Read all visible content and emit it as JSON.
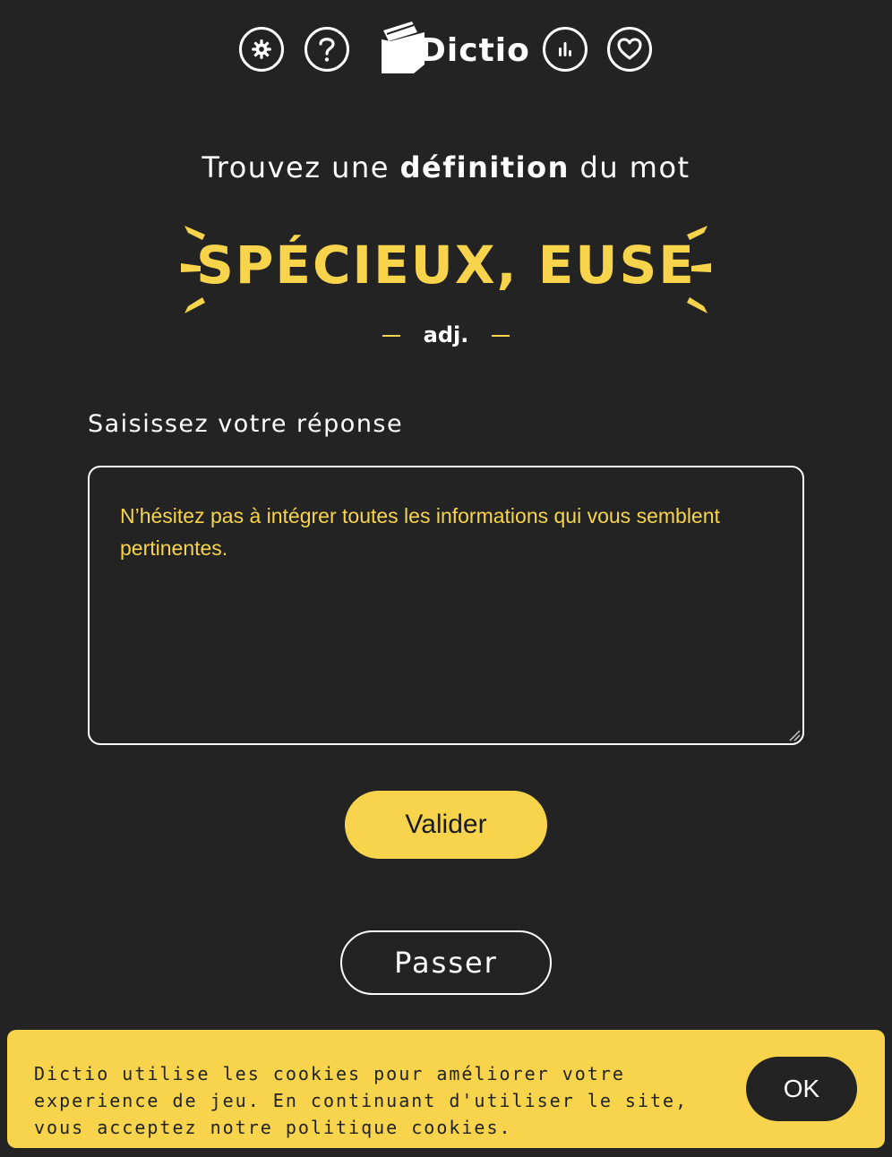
{
  "header": {
    "logo_text": "Dictio",
    "icons": [
      "settings-icon",
      "help-icon",
      "stats-icon",
      "heart-icon"
    ]
  },
  "intro": {
    "prefix": "Trouvez une ",
    "emphasis": "définition",
    "suffix": " du mot"
  },
  "word": {
    "text": "SPÉCIEUX, EUSE",
    "category": "adj."
  },
  "answer": {
    "label": "Saisissez votre réponse",
    "placeholder": "N’hésitez pas à intégrer toutes les informations qui vous semblent pertinentes.",
    "value": ""
  },
  "buttons": {
    "validate": "Valider",
    "skip": "Passer"
  },
  "cookie_banner": {
    "text": "Dictio utilise les cookies pour améliorer votre experience de jeu. En continuant d'utiliser le site, vous acceptez notre politique cookies.",
    "ok_label": "OK"
  },
  "colors": {
    "background": "#232323",
    "accent": "#f7d44b",
    "text": "#ffffff"
  }
}
